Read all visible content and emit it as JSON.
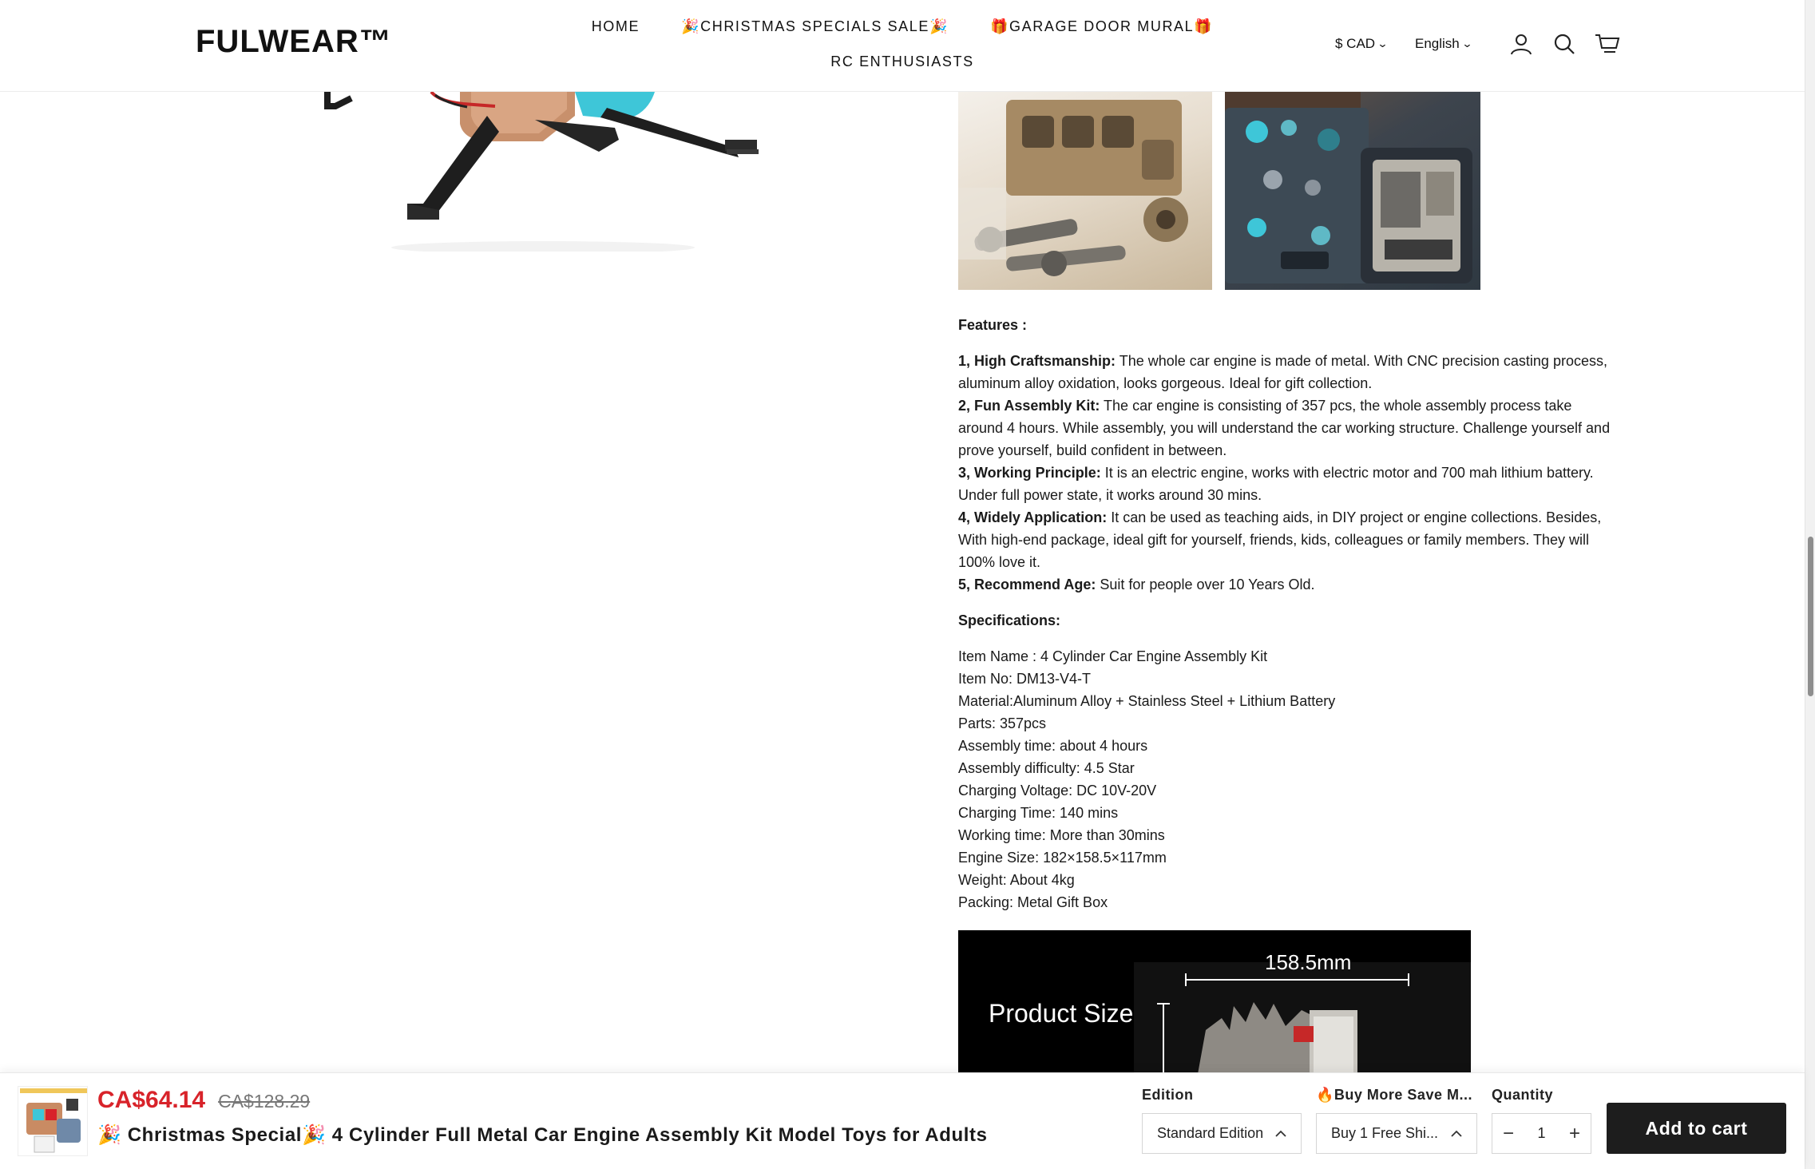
{
  "header": {
    "logo": "FULWEAR™",
    "nav": {
      "home": "HOME",
      "christmas": "🎉CHRISTMAS SPECIALS SALE🎉",
      "garage": "🎁GARAGE DOOR MURAL🎁",
      "rc": "RC ENTHUSIASTS"
    },
    "currency": "$ CAD",
    "language": "English",
    "icons": [
      "account-icon",
      "search-icon",
      "cart-icon"
    ]
  },
  "description": {
    "features_heading": "Features :",
    "features": [
      {
        "title": "1, High Craftsmanship:",
        "text": " The whole car engine is made of metal. With CNC precision casting process, aluminum alloy oxidation, looks gorgeous. Ideal for gift collection."
      },
      {
        "title": "2, Fun Assembly Kit:",
        "text": " The car engine is consisting of 357 pcs, the whole assembly process take around 4 hours. While assembly, you will understand the car working structure. Challenge yourself and prove yourself, build confident in between."
      },
      {
        "title": "3, Working Principle:",
        "text": " It is an electric engine, works with electric motor and 700 mah lithium battery. Under full power state, it works around 30 mins."
      },
      {
        "title": "4, Widely Application:",
        "text": " It can be used as teaching aids, in DIY project or engine collections. Besides, With high-end package, ideal gift for yourself, friends, kids, colleagues or family members. They will 100% love it."
      },
      {
        "title": "5, Recommend Age:",
        "text": " Suit for people over 10 Years Old."
      }
    ],
    "specs_heading": "Specifications:",
    "specs": [
      "Item Name : 4 Cylinder Car Engine Assembly Kit",
      "Item No: DM13-V4-T",
      "Material:Aluminum Alloy + Stainless Steel + Lithium Battery",
      "Parts: 357pcs",
      "Assembly time: about 4 hours",
      "Assembly difficulty: 4.5 Star",
      "Charging Voltage: DC 10V-20V",
      "Charging Time: 140 mins",
      "Working time: More than 30mins",
      "Engine Size: 182×158.5×117mm",
      "Weight: About 4kg",
      "Packing: Metal Gift Box"
    ],
    "size_banner": {
      "title": "Product Size",
      "dimension": "158.5mm"
    }
  },
  "sticky_bar": {
    "price_sale": "CA$64.14",
    "price_old": "CA$128.29",
    "title": "🎉 Christmas Special🎉 4 Cylinder Full Metal Car Engine Assembly Kit Model Toys for Adults",
    "edition_label": "Edition",
    "edition_value": "Standard Edition",
    "bundle_label": "🔥Buy More Save M...",
    "bundle_value": "Buy 1 Free Shi...",
    "quantity_label": "Quantity",
    "quantity_value": "1",
    "qty_minus": "−",
    "qty_plus": "+",
    "add_to_cart": "Add to cart"
  },
  "colors": {
    "sale_price": "#d8232a",
    "button_bg": "#1d1d1d",
    "accent_cyan": "#3ec6d8"
  }
}
